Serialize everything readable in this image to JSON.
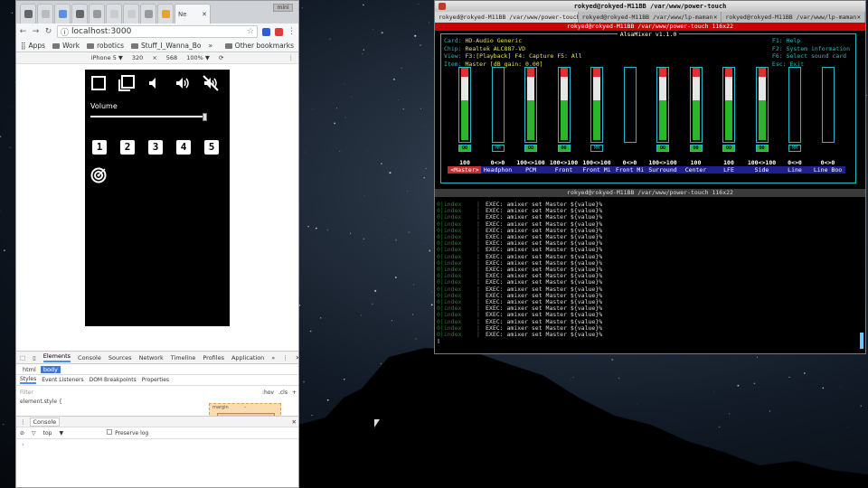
{
  "browser": {
    "active_tab_label": "Ne",
    "window_control": "mini",
    "url": "localhost:3000",
    "bookmarks": [
      "Apps",
      "Work",
      "robotics",
      "Stuff_I_Wanna_Bo"
    ],
    "more_bookmarks": "»",
    "other_bookmarks": "Other bookmarks",
    "device": "iPhone 5 ▼",
    "width": "320",
    "times": "×",
    "height": "568",
    "zoom": "100% ▼",
    "more": "⋮"
  },
  "app": {
    "volume_label": "Volume",
    "volume_level": 1.0,
    "number_buttons": [
      "1",
      "2",
      "3",
      "4",
      "5"
    ]
  },
  "devtools": {
    "tabs": [
      "Elements",
      "Console",
      "Sources",
      "Network",
      "Timeline",
      "Profiles",
      "Application",
      "»"
    ],
    "breadcrumb": [
      "html",
      "body"
    ],
    "style_tabs": [
      "Styles",
      "Event Listeners",
      "DOM Breakpoints",
      "Properties"
    ],
    "filter_placeholder": "Filter",
    "hov": ":hov",
    "cls": ".cls",
    "plus": "+",
    "element_style": "element.style {",
    "margin_label": "margin",
    "margin_value": "–",
    "console_title": "Console",
    "context": "top",
    "preserve_log": "Preserve log",
    "prompt": "›"
  },
  "terminal": {
    "title": "rokyed@rokyed-M11BB /var/www/power-touch",
    "tabs": [
      "rokyed@rokyed-M11BB /var/www/power-touch",
      "rokyed@rokyed-M11BB /var/www/lp-maman",
      "rokyed@rokyed-M11BB /var/www/lp-maman"
    ],
    "top_pane_title": "rokyed@rokyed-M11BB /var/www/power-touch 116x22",
    "bottom_pane_title": "rokyed@rokyed-M11BB /var/www/power-touch 116x22",
    "alsa_title": "AlsaMixer v1.1.0",
    "info": {
      "card_label": "Card:",
      "card": "HD-Audio Generic",
      "chip_label": "Chip:",
      "chip": "Realtek ALC887-VD",
      "view_label": "View:",
      "view": "F3:[Playback] F4: Capture  F5: All",
      "item_label": "Item:",
      "item": "Master [dB gain: 0.00]"
    },
    "help": [
      "F1:  Help",
      "F2:  System information",
      "F6:  Select sound card",
      "Esc: Exit"
    ],
    "channels": [
      {
        "name": "Master",
        "value": "100",
        "level": 1.0,
        "mute": "OO",
        "selected": true
      },
      {
        "name": "Headphon",
        "value": "0<>0",
        "level": 0.0,
        "mute": "MM"
      },
      {
        "name": "PCM",
        "value": "100<>100",
        "level": 1.0,
        "mute": "OO"
      },
      {
        "name": "Front",
        "value": "100<>100",
        "level": 1.0,
        "mute": "OO"
      },
      {
        "name": "Front Mi",
        "value": "100<>100",
        "level": 1.0,
        "mute": "MM"
      },
      {
        "name": "Front Mi",
        "value": "0<>0",
        "level": 0.0,
        "mute": ""
      },
      {
        "name": "Surround",
        "value": "100<>100",
        "level": 1.0,
        "mute": "OO"
      },
      {
        "name": "Center",
        "value": "100",
        "level": 1.0,
        "mute": "OO"
      },
      {
        "name": "LFE",
        "value": "100",
        "level": 1.0,
        "mute": "OO"
      },
      {
        "name": "Side",
        "value": "100<>100",
        "level": 1.0,
        "mute": "OO"
      },
      {
        "name": "Line",
        "value": "0<>0",
        "level": 0.0,
        "mute": "MM"
      },
      {
        "name": "Line Boo",
        "value": "0<>0",
        "level": 0.0,
        "mute": ""
      }
    ],
    "log_label": "0|index",
    "log_sep": "|",
    "log_text": "EXEC: amixer set Master ${value}%",
    "log_rows": 21
  }
}
